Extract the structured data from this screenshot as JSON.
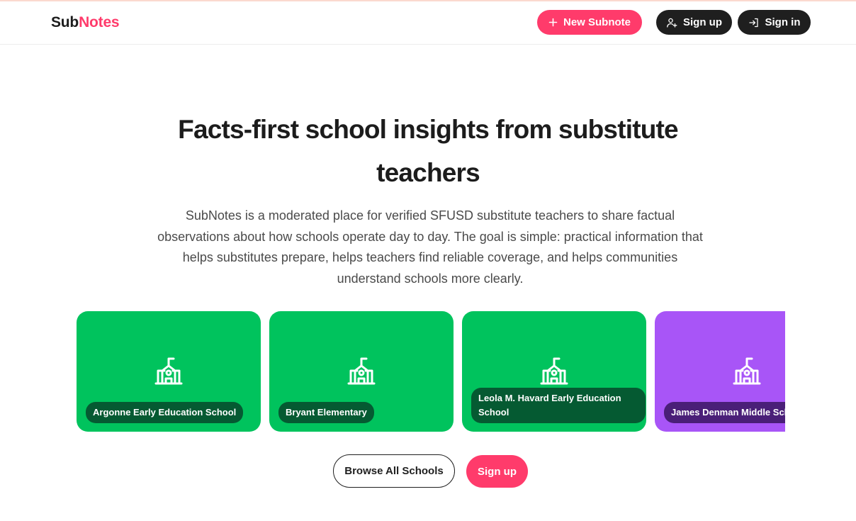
{
  "header": {
    "logo_part1": "Sub",
    "logo_part2": "Notes",
    "new_subnote_label": "New Subnote",
    "sign_up_label": "Sign up",
    "sign_in_label": "Sign in"
  },
  "hero": {
    "title": "Facts-first school insights from substitute teachers",
    "description": "SubNotes is a moderated place for verified SFUSD substitute teachers to share factual observations about how schools operate day to day. The goal is simple: practical information that helps substitutes prepare, helps teachers find reliable coverage, and helps communities understand schools more clearly."
  },
  "schools": [
    {
      "name": "Argonne Early Education School",
      "color": "#00c35d"
    },
    {
      "name": "Bryant Elementary",
      "color": "#00c35d"
    },
    {
      "name": "Leola M. Havard Early Education School",
      "color": "#00c35d"
    },
    {
      "name": "James Denman Middle School",
      "color": "#a855f7"
    }
  ],
  "actions": {
    "browse_label": "Browse All Schools",
    "signup_label": "Sign up"
  },
  "colors": {
    "brand_pink": "#ff3b6b",
    "dark": "#1f1f1f",
    "card_green": "#00c35d",
    "card_purple": "#a855f7"
  },
  "icons": [
    "plus-icon",
    "user-plus-icon",
    "sign-in-icon",
    "school-icon"
  ]
}
